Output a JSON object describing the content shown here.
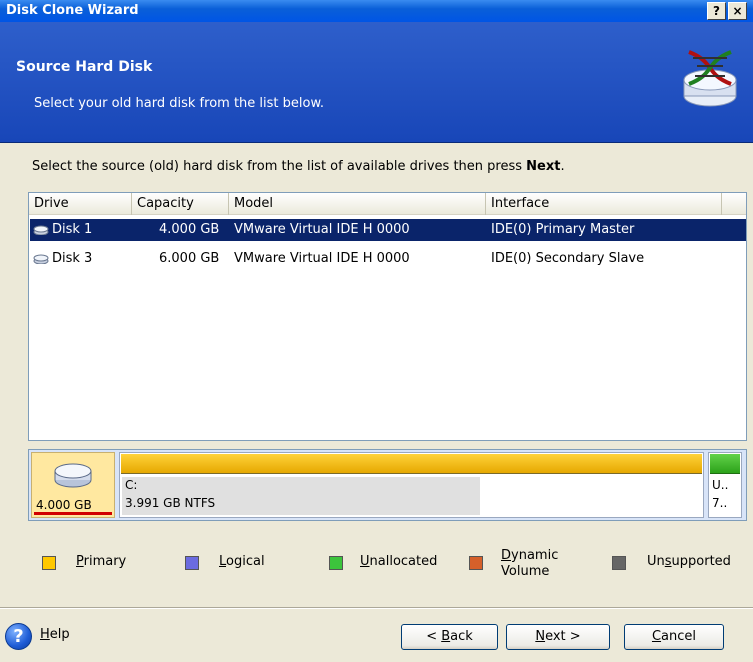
{
  "window": {
    "title": "Disk Clone Wizard",
    "help_btn": "?",
    "close_btn": "×"
  },
  "header": {
    "title": "Source Hard Disk",
    "subtitle": "Select your old hard disk from the list below."
  },
  "instruction": {
    "text": "Select the source (old) hard disk from the list of available drives then press ",
    "bold": "Next",
    "end": "."
  },
  "table": {
    "columns": [
      "Drive",
      "Capacity",
      "Model",
      "Interface"
    ],
    "rows": [
      {
        "drive": "Disk 1",
        "capacity": "4.000 GB",
        "model": "VMware Virtual IDE H 0000",
        "interface": "IDE(0) Primary Master",
        "selected": true
      },
      {
        "drive": "Disk 3",
        "capacity": "6.000 GB",
        "model": "VMware Virtual IDE H 0000",
        "interface": "IDE(0) Secondary Slave",
        "selected": false
      }
    ]
  },
  "diskmap": {
    "disk_capacity": "4.000 GB",
    "partition_c": {
      "label": "C:",
      "detail": "3.991 GB  NTFS"
    },
    "partition_u": {
      "label": "U..",
      "detail": "7.."
    }
  },
  "legend": {
    "primary": {
      "before": "",
      "key": "P",
      "after": "rimary",
      "color": "#FFC800"
    },
    "logical": {
      "before": "",
      "key": "L",
      "after": "ogical",
      "color": "#6B6BE0"
    },
    "unallocated": {
      "before": "",
      "key": "U",
      "after": "nallocated",
      "color": "#3CC43C"
    },
    "dynamic": {
      "line1_key": "D",
      "line1_rest": "ynamic",
      "line2": "Volume",
      "color": "#D5602A"
    },
    "unsupported": {
      "before": "Un",
      "key": "s",
      "after": "upported",
      "color": "#666666"
    }
  },
  "footer": {
    "help": {
      "key": "H",
      "rest": "elp"
    },
    "back": {
      "before": "< ",
      "key": "B",
      "after": "ack"
    },
    "next": {
      "key": "N",
      "after": "ext >"
    },
    "cancel": {
      "key": "C",
      "after": "ancel"
    }
  },
  "colors": {
    "header_bg": "#1846B8",
    "selection_bg": "#0A246A"
  }
}
